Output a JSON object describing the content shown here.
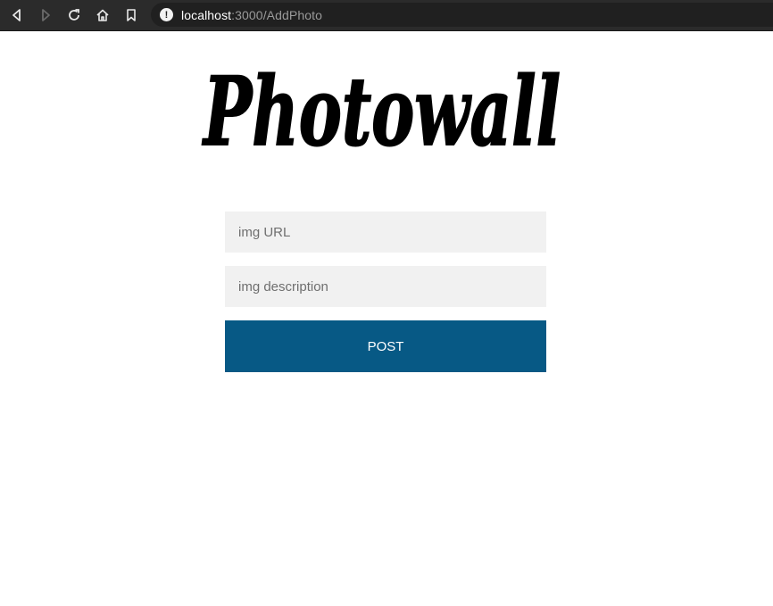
{
  "browser": {
    "url_host": "localhost",
    "url_path": ":3000/AddPhoto",
    "icons": [
      "back-icon",
      "forward-icon",
      "reload-icon",
      "home-icon",
      "bookmark-icon",
      "info-icon"
    ]
  },
  "logo": {
    "text": "Photowall"
  },
  "form": {
    "url_placeholder": "img URL",
    "description_placeholder": "img description",
    "post_label": "POST"
  },
  "colors": {
    "accent": "#075985",
    "input_bg": "#f1f1f1",
    "toolbar_bg": "#2b2b2b"
  }
}
